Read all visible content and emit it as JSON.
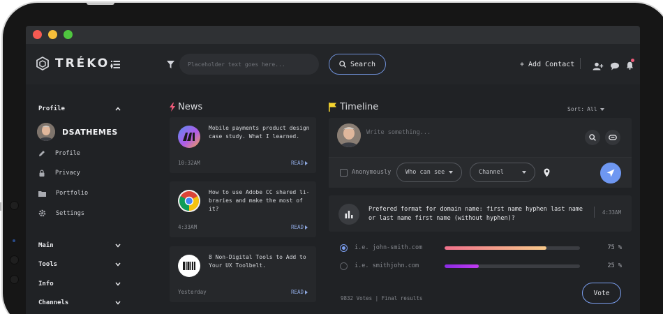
{
  "app": {
    "logo_text": "TRÉKO."
  },
  "header": {
    "search_placeholder": "Placeholder text goes here...",
    "search_button": "Search",
    "add_contact": "+ Add Contact"
  },
  "sidebar": {
    "profile_section": "Profile",
    "username": "DSATHEMES",
    "items": [
      {
        "label": "Profile",
        "icon": "pencil-icon"
      },
      {
        "label": "Privacy",
        "icon": "lock-icon"
      },
      {
        "label": "Portfolio",
        "icon": "folder-icon"
      },
      {
        "label": "Settings",
        "icon": "gear-icon"
      }
    ],
    "sections": [
      "Main",
      "Tools",
      "Info",
      "Channels"
    ]
  },
  "news": {
    "title": "News",
    "read_label": "READ",
    "items": [
      {
        "text": "Mobile payments product design case study. What I learned.",
        "time": "10:32AM"
      },
      {
        "text": "How to use Adobe CC shared li-braries and make the most of it?",
        "time": "4:33AM"
      },
      {
        "text": "8 Non-Digital Tools to Add to Your UX Toolbelt.",
        "time": "Yesterday"
      }
    ]
  },
  "timeline": {
    "title": "Timeline",
    "sort_label": "Sort:",
    "sort_value": "All",
    "composer_placeholder": "Write something...",
    "anonymously": "Anonymously",
    "who_can_see": "Who can see",
    "channel": "Channel",
    "poll": {
      "question": "Prefered format for domain name: first name hyphen last name or last name first name (without hyphen)?",
      "time": "4:33AM",
      "options": [
        {
          "label": "i.e. john-smith.com",
          "percent": 75,
          "pct_label": "75 %",
          "selected": true
        },
        {
          "label": "i.e. smithjohn.com",
          "percent": 25,
          "pct_label": "25 %",
          "selected": false
        }
      ],
      "footer": "9832 Votes | Final results",
      "vote_button": "Vote"
    }
  },
  "colors": {
    "accent": "#6e97f1",
    "bar1_start": "#f0718b",
    "bar1_end": "#f7c98a",
    "bar2_start": "#8a2be2",
    "bar2_end": "#c13bf0",
    "flag": "#f6d52f",
    "bolt": "#f05b7a"
  }
}
